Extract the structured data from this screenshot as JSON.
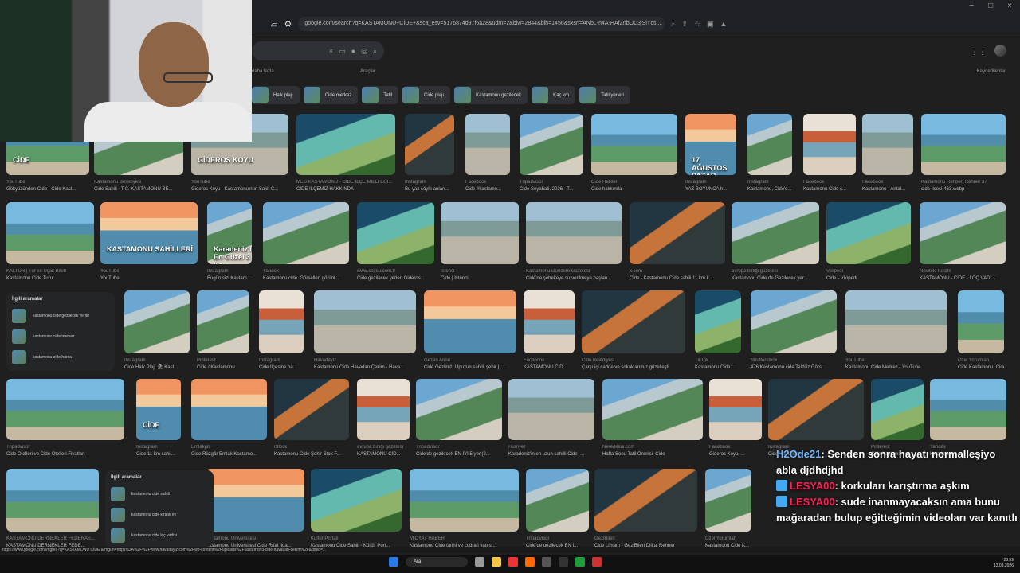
{
  "browser": {
    "url": "google.com/search?q=KASTAMONU+CİDE+&sca_esv=5176874d97f6a28&udm=2&biw=2844&bih=1456&sxsrf=ANbL-n4A-HAfZnbOC3jSiYcs...",
    "window_controls": [
      "−",
      "□",
      "×"
    ]
  },
  "search": {
    "query": "",
    "more": "daha fazla",
    "tools": "Araçlar",
    "saved": "Kaydedilenler"
  },
  "chips": [
    "Halk plajı",
    "Cide merkez",
    "Tatil",
    "Cide plajı",
    "Kastamonu gezilecek",
    "Kaç km",
    "Tatil yerleri"
  ],
  "results": [
    {
      "s": "YouTube",
      "c": "Gökyüzünden Cide - Cide Kast...",
      "o": "CİDE"
    },
    {
      "s": "Kastamonu Belediyesi",
      "c": "Cide Sahili - T.C. KASTAMONU BE..."
    },
    {
      "s": "YouTube",
      "c": "Gideros Koyu - Kastamonu'nun Saklı C...",
      "o": "GİDEROS KOYU"
    },
    {
      "s": "MEB KASTAMONU - CİDE İLÇE MİLLİ EĞİ...",
      "c": "CİDE İLÇEMİZ HAKKINDA"
    },
    {
      "s": "Instagram",
      "c": "Bu yaz şöyle anları..."
    },
    {
      "s": "Facebook",
      "c": "Cide #kastamo..."
    },
    {
      "s": "Tripadvisor",
      "c": "Cide Seyahati, 2026 - T..."
    },
    {
      "s": "Cide Halkleri",
      "c": "Cide hakkında -"
    },
    {
      "s": "Instagram",
      "c": "YAZ BOYUNCA h...",
      "o": "17 AĞUSTOS PAZAR GÜNÜBİRLİK CİDE TURU"
    },
    {
      "s": "Instagram",
      "c": "Kastamonu, Cide'd..."
    },
    {
      "s": "Facebook",
      "c": "Kastamonu Cide s..."
    },
    {
      "s": "Facebook",
      "c": "Kastamonu - Antal..."
    },
    {
      "s": "Kastamonu Rehberi Rehber 37",
      "c": "cide-ilcesi-463.webp"
    },
    {
      "s": "KALTUR | Tur ve Uçak Bileti",
      "c": "Kastamonu Cide Turu"
    },
    {
      "s": "YouTube",
      "c": "YouTube",
      "o": "KASTAMONU SAHİLLERİ"
    },
    {
      "s": "Instagram",
      "c": "Bugün sizi Kastam...",
      "o": "Karadeniz'in En Güzel 3 Koyu"
    },
    {
      "s": "Yandex",
      "c": "Kastamonu cide. Görselleri görünt..."
    },
    {
      "s": "www.sozcu.com.tr",
      "c": "Cide gezilecek yerler. Gideros..."
    },
    {
      "s": "İstenci",
      "c": "Cide | İstenci"
    },
    {
      "s": "Kastamonu Gündem Gazetesi",
      "c": "Cide'de şebekeye su verilmeye başlan..."
    },
    {
      "s": "x.com",
      "c": "Cide - Kastamonu Cide sahili 11 km k..."
    },
    {
      "s": "avrupa birliği gazetesi",
      "c": "Kastamonu Cide de Gezilecek yer..."
    },
    {
      "s": "Vikipedi",
      "c": "Cide - Vikipedi"
    },
    {
      "s": "Novitek Turizm",
      "c": "KASTAMONU - CİDE - LOÇ VADİ..."
    },
    {
      "s": "Instagram",
      "c": "Cide Halk Plajı 🏖 Kast..."
    },
    {
      "s": "Pinterest",
      "c": "Cide / Kastamonu"
    },
    {
      "s": "Instagram",
      "c": "Cide İlçesine ba..."
    },
    {
      "s": "Havadayiz",
      "c": "Kastamonu Cide Havadan Çekim - Hava..."
    },
    {
      "s": "Gezen Anne",
      "c": "Cide Gezimiz: Upuzun sahilli şehir | ..."
    },
    {
      "s": "Facebook",
      "c": "KASTAMONU CİD..."
    },
    {
      "s": "Cide Belediyesi",
      "c": "Çarşı içi cadde ve sokaklarımız güzelleşti"
    },
    {
      "s": "TikTok",
      "c": "Kastamonu Cide:..."
    },
    {
      "s": "Shutterstock",
      "c": "476 Kastamonu cide Telifsiz Görs..."
    },
    {
      "s": "YouTube",
      "c": "Kastamonu Cide Merkez - YouTube"
    },
    {
      "s": "Özel Yorumlan",
      "c": "Cide Kastamonu, Cide K..."
    },
    {
      "s": "Tripadvisor",
      "c": "Cide Otelleri ve Cide Otelleri Fiyatları"
    },
    {
      "s": "Instagram",
      "c": "Cide 11 km sahil...",
      "o": "CİDE"
    },
    {
      "s": "Emlakjet",
      "c": "Cide Rüzgâr Emlak Kastamo..."
    },
    {
      "s": "iStock",
      "c": "Kastamonu Cide Şehir Stok F..."
    },
    {
      "s": "avrupa birliği gazetesi",
      "c": "KASTAMONU CİD..."
    },
    {
      "s": "Tripadvisor",
      "c": "Cide'de gezilecek EN İYİ 5 yer (2..."
    },
    {
      "s": "Hürriyet",
      "c": "Karadeniz'in en uzun sahilli Cide -..."
    },
    {
      "s": "Neredekal.com",
      "c": "Hafta Sonu Tatil Önerisi: Cide"
    },
    {
      "s": "Facebook",
      "c": "Gideros Koyu, ..."
    },
    {
      "s": "Instagram",
      "c": "Cide Kastamonu..."
    },
    {
      "s": "Pinterest",
      "c": "Cide Kastamonu..."
    },
    {
      "s": "Yandex",
      "c": "Kastamonu, ..."
    },
    {
      "s": "KASTAMONU DERNEKLER FEDERAS...",
      "c": "KASTAMONU DERNEKLER FEDE..."
    },
    {
      "s": "Kastamonu Üniversitesi",
      "c": "Kastamonu Üniversitesi Cide Rıfat Ilga..."
    },
    {
      "s": "Kültür Portalı",
      "c": "Kastamonu Cide Sahili - Kültür Port..."
    },
    {
      "s": "MİDYAT HABER",
      "c": "Kastamonu Cide tarihi ve coğrafi yapısı..."
    },
    {
      "s": "Tripadvisor",
      "c": "Cide'de gezilecek EN İ..."
    },
    {
      "s": "GeziBilen",
      "c": "Cide Limanı - GeziBilen Dijital Rehber"
    },
    {
      "s": "Özel Yorumlan",
      "c": "Kastamonu Cide K..."
    }
  ],
  "related1": {
    "title": "İlgili aramalar",
    "items": [
      "kastamonu cide gezilecek yerler",
      "kastamonu cide merkez",
      "kastamonu cide harita"
    ]
  },
  "related2": {
    "title": "İlgili aramalar",
    "items": [
      "kastamonu cide sahili",
      "kastamonu cide kiralık ev",
      "kastamonu cide loç vadisi"
    ]
  },
  "chat": [
    {
      "user": "H2Ode21",
      "msg": ": Senden sonra hayatı normalleşiyo abla djdhdjhd"
    },
    {
      "user": "LESYA00",
      "msg": ": korkuları karıştırma aşkım"
    },
    {
      "user": "LESYA00",
      "msg": ": sude inanmayacaksın ama bunu mağaradan bulup eğitteğimin videoları var kanıtlı"
    }
  ],
  "status": "https://www.google.com/imgres?q=KASTAMONU CİDE &imgurl=https%3A%2F%2Fwww.havadayiz.com%2Fwp-content%2Fuploads%2Fkastamonu-cide-havadan-cekim%2F&tbnid=...",
  "taskbar": {
    "search": "Ara",
    "time": "23:39",
    "date": "13.03.2026"
  }
}
